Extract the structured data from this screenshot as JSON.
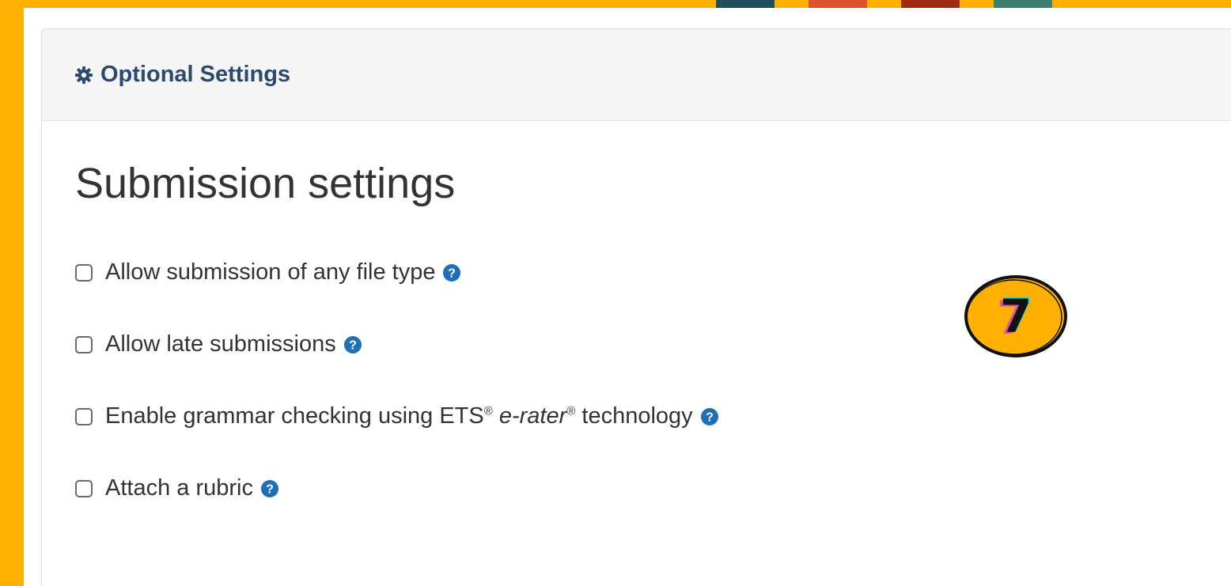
{
  "colors": {
    "background": "#FFB000",
    "deco_blocks": [
      "#1f4e5f",
      "#e0522d",
      "#9e2b12",
      "#3f7f71"
    ],
    "panel_title": "#2c4a6b",
    "help_icon": "#1f6fb5",
    "badge_fill": "#FFB000"
  },
  "panel": {
    "icon": "gear-icon",
    "title": "Optional Settings"
  },
  "section": {
    "title": "Submission settings"
  },
  "options": [
    {
      "label": "Allow submission of any file type",
      "checked": false,
      "help_icon": "question-circle-icon"
    },
    {
      "label": "Allow late submissions",
      "checked": false,
      "help_icon": "question-circle-icon"
    },
    {
      "label_parts": {
        "before": "Enable grammar checking using ETS",
        "reg1": "®",
        "italic": "e-rater",
        "reg2": "®",
        "after": " technology"
      },
      "checked": false,
      "help_icon": "question-circle-icon"
    },
    {
      "label": "Attach a rubric",
      "checked": false,
      "help_icon": "question-circle-icon"
    }
  ],
  "callout": {
    "number": "7"
  }
}
